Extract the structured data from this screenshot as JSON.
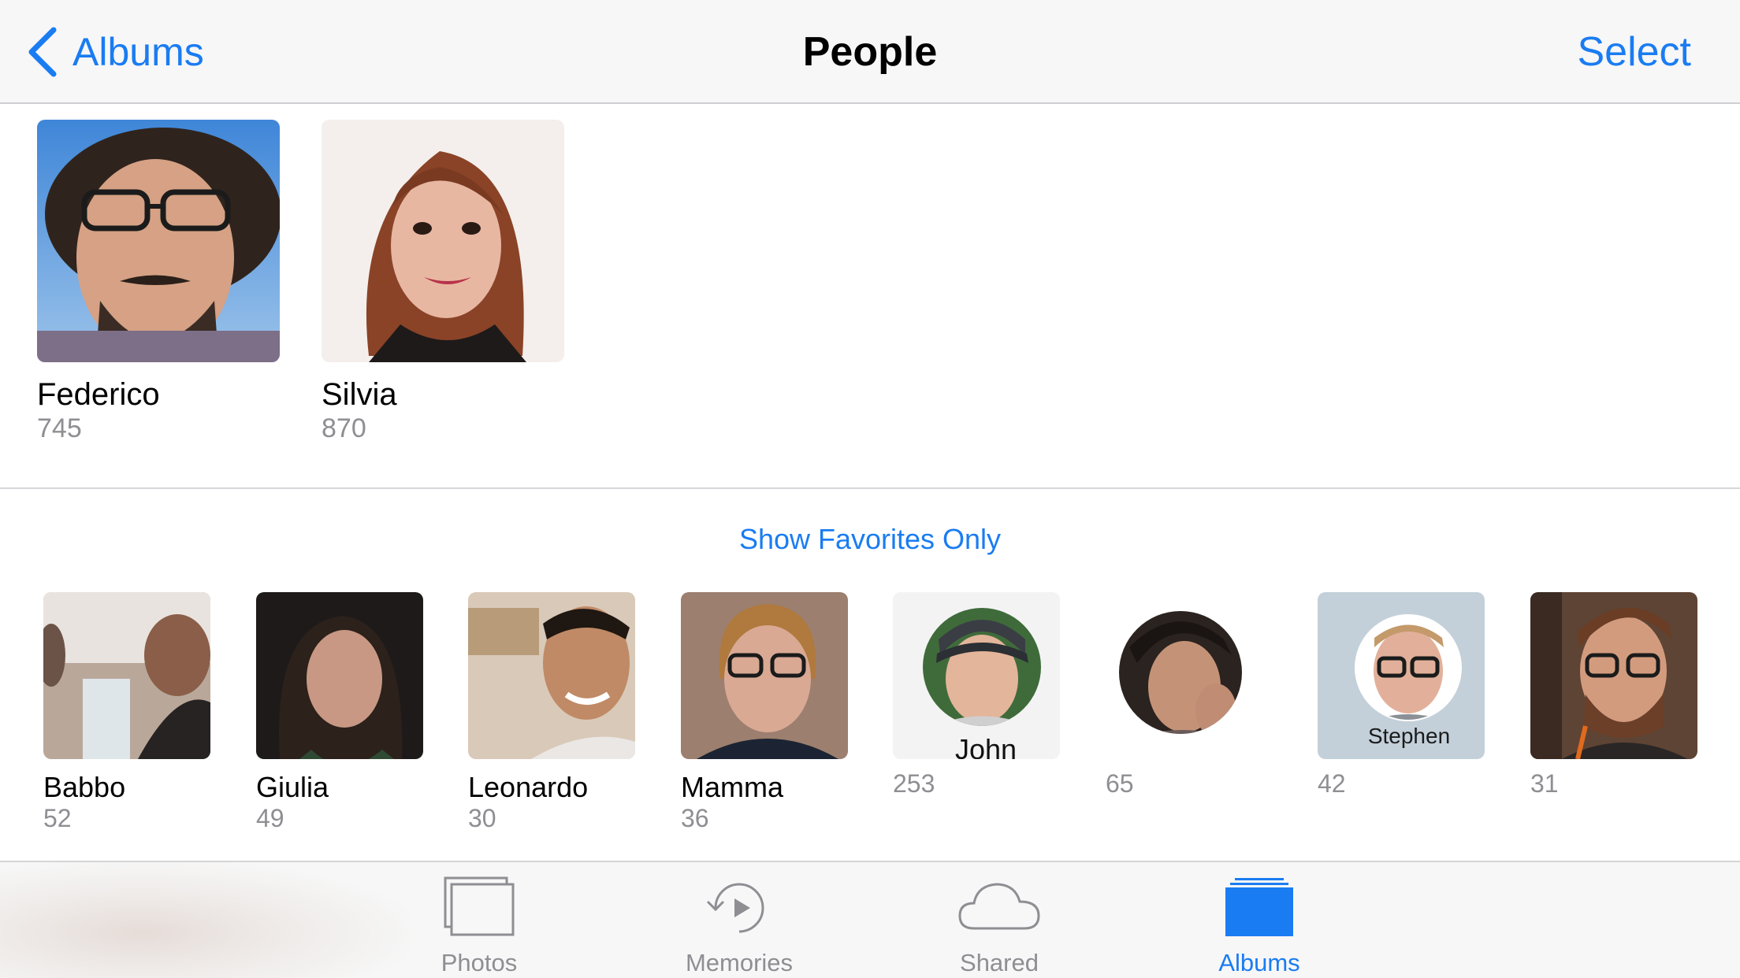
{
  "nav": {
    "back_label": "Albums",
    "title": "People",
    "select_label": "Select"
  },
  "favorites": [
    {
      "name": "Federico",
      "count": "745"
    },
    {
      "name": "Silvia",
      "count": "870"
    }
  ],
  "show_favorites_label": "Show Favorites Only",
  "people": [
    {
      "name": "Babbo",
      "count": "52"
    },
    {
      "name": "Giulia",
      "count": "49"
    },
    {
      "name": "Leonardo",
      "count": "30"
    },
    {
      "name": "Mamma",
      "count": "36"
    },
    {
      "name": "",
      "count": "253",
      "photo_text": "John"
    },
    {
      "name": "",
      "count": "65"
    },
    {
      "name": "",
      "count": "42",
      "photo_text": "Stephen"
    },
    {
      "name": "",
      "count": "31"
    }
  ],
  "tabs": [
    {
      "label": "Photos",
      "icon": "photos-icon",
      "active": false
    },
    {
      "label": "Memories",
      "icon": "memories-icon",
      "active": false
    },
    {
      "label": "Shared",
      "icon": "shared-cloud-icon",
      "active": false
    },
    {
      "label": "Albums",
      "icon": "albums-icon",
      "active": true
    }
  ],
  "colors": {
    "accent": "#1a7cf2",
    "secondary_text": "#8e8e93",
    "bar_bg": "#f7f7f7"
  }
}
